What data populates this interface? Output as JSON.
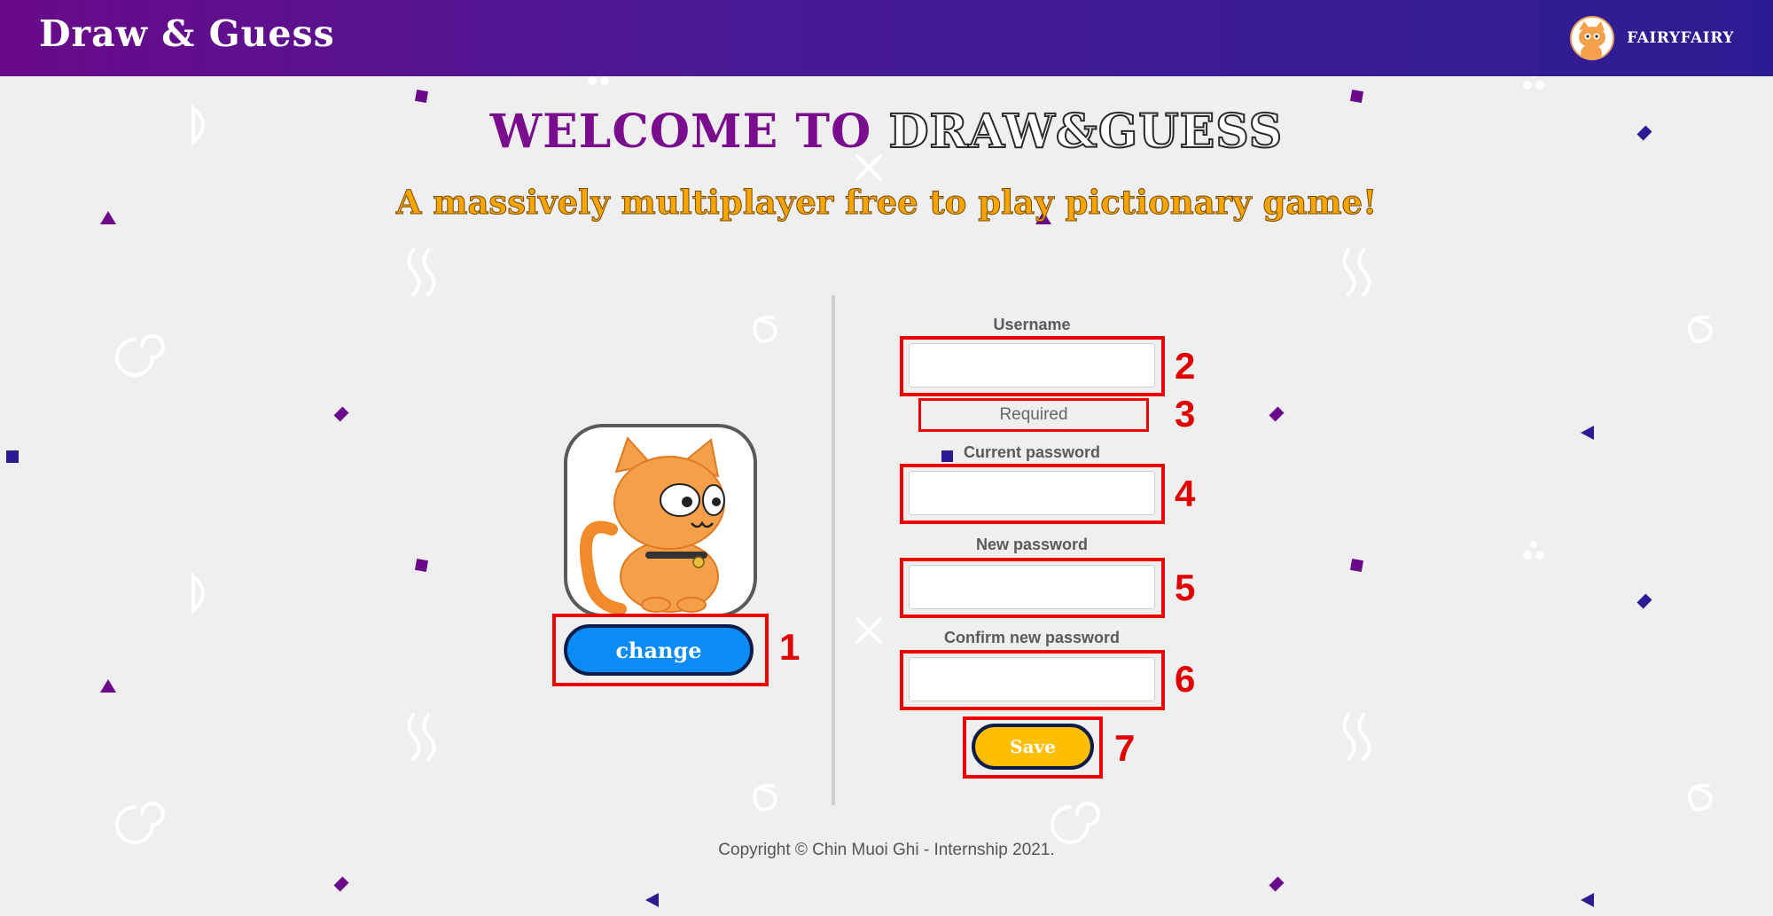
{
  "header": {
    "brand": "Draw & Guess",
    "username": "FAIRYFAIRY"
  },
  "hero": {
    "welcome_part1": "WELCOME TO",
    "welcome_part2": "DRAW&GUESS",
    "tagline": "A massively multiplayer free to play pictionary game!"
  },
  "profile": {
    "change_button": "change"
  },
  "form": {
    "username_label": "Username",
    "username_value": "",
    "required_text": "Required",
    "current_password_label": "Current password",
    "new_password_label": "New password",
    "confirm_password_label": "Confirm new password",
    "save_button": "Save"
  },
  "annotations": [
    "1",
    "2",
    "3",
    "4",
    "5",
    "6",
    "7"
  ],
  "footer": {
    "copyright": "Copyright © Chin Muoi Ghi - Internship 2021."
  },
  "colors": {
    "nav_start": "#6a0a8a",
    "nav_end": "#2c1c93",
    "welcome_purple": "#7a0c8e",
    "tagline_orange": "#f6a500",
    "change_blue": "#0a8bf5",
    "save_yellow": "#ffbe00",
    "highlight_red": "#ee0000"
  }
}
